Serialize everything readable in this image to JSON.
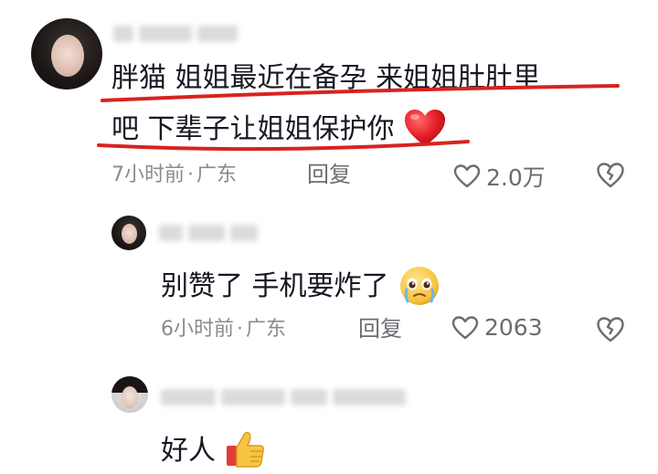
{
  "comments": [
    {
      "text_line1": "胖猫  姐姐最近在备孕  来姐姐肚肚里",
      "text_line2": "吧  下辈子让姐姐保护你",
      "time": "7小时前",
      "sep": "·",
      "location": "广东",
      "reply_label": "回复",
      "likes": "2.0万",
      "emoji": "heart-emoji"
    },
    {
      "text": "别赞了 手机要炸了",
      "time": "6小时前",
      "sep": "·",
      "location": "广东",
      "reply_label": "回复",
      "likes": "2063",
      "emoji": "crying-face-emoji"
    },
    {
      "text": "好人",
      "emoji": "thumbs-up-emoji"
    }
  ],
  "colors": {
    "annotation_red": "#d8231f",
    "text": "#161823",
    "meta": "#8a8b91"
  }
}
